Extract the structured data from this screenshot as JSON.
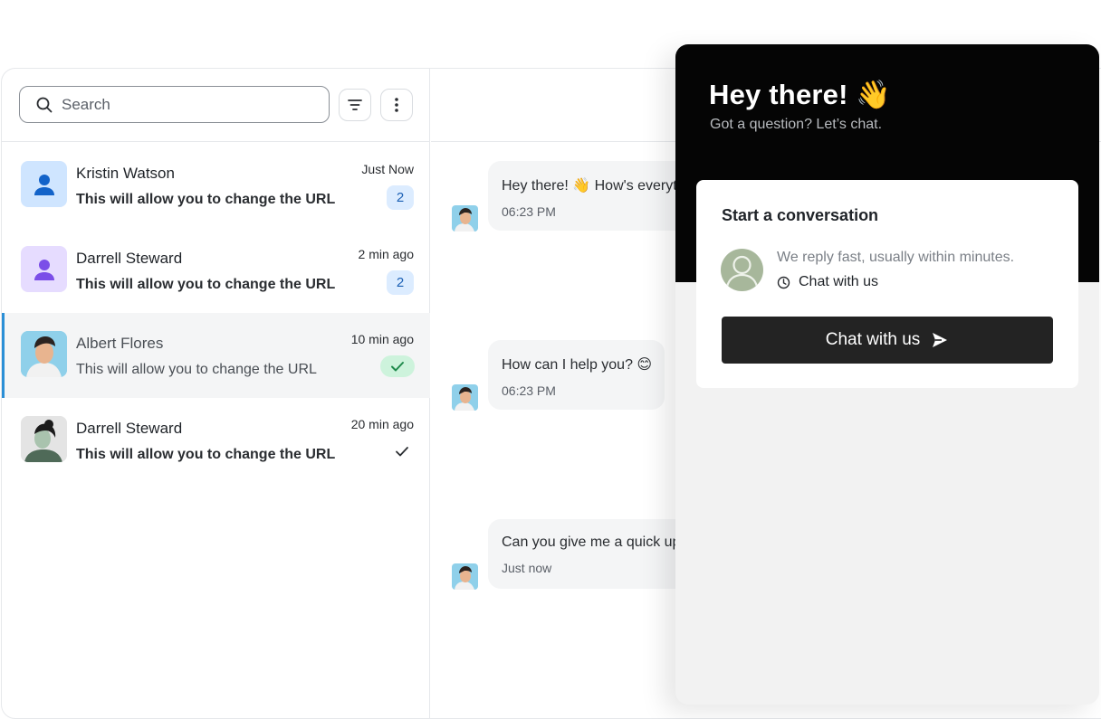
{
  "search": {
    "placeholder": "Search"
  },
  "contacts": [
    {
      "name": "Kristin Watson",
      "preview": "This will allow you to change the URL",
      "time": "Just Now",
      "unread": "2",
      "avatar": "user-icon-blue"
    },
    {
      "name": "Darrell Steward",
      "preview": "This will allow you to change the URL",
      "time": "2 min ago",
      "unread": "2",
      "avatar": "user-icon-purple"
    },
    {
      "name": "Albert Flores",
      "preview": "This will allow you to change the URL",
      "time": "10 min ago",
      "status": "read",
      "avatar": "photo-avatar"
    },
    {
      "name": "Darrell Steward",
      "preview": "This will allow you to change the URL",
      "time": "20 min ago",
      "status": "delivered",
      "avatar": "illustrated-avatar"
    }
  ],
  "messages": [
    {
      "text": "Hey there! 👋 How's everyt",
      "time": "06:23 PM"
    },
    {
      "text": "How can I help you? 😊",
      "time": "06:23 PM"
    },
    {
      "text": "Can you give me a quick up",
      "time": "Just now"
    }
  ],
  "widget": {
    "title": "Hey there! 👋",
    "subtitle": "Got a question? Let’s chat.",
    "card_title": "Start a conversation",
    "reply_note": "We reply fast, usually within minutes.",
    "reply_meta": "Chat with us",
    "cta_label": "Chat with us"
  },
  "colors": {
    "accent": "#2b8fd6",
    "widget_header": "#050505",
    "cta": "#232323",
    "unread_badge": "#dcecff",
    "read_badge": "#cdf3dc"
  }
}
